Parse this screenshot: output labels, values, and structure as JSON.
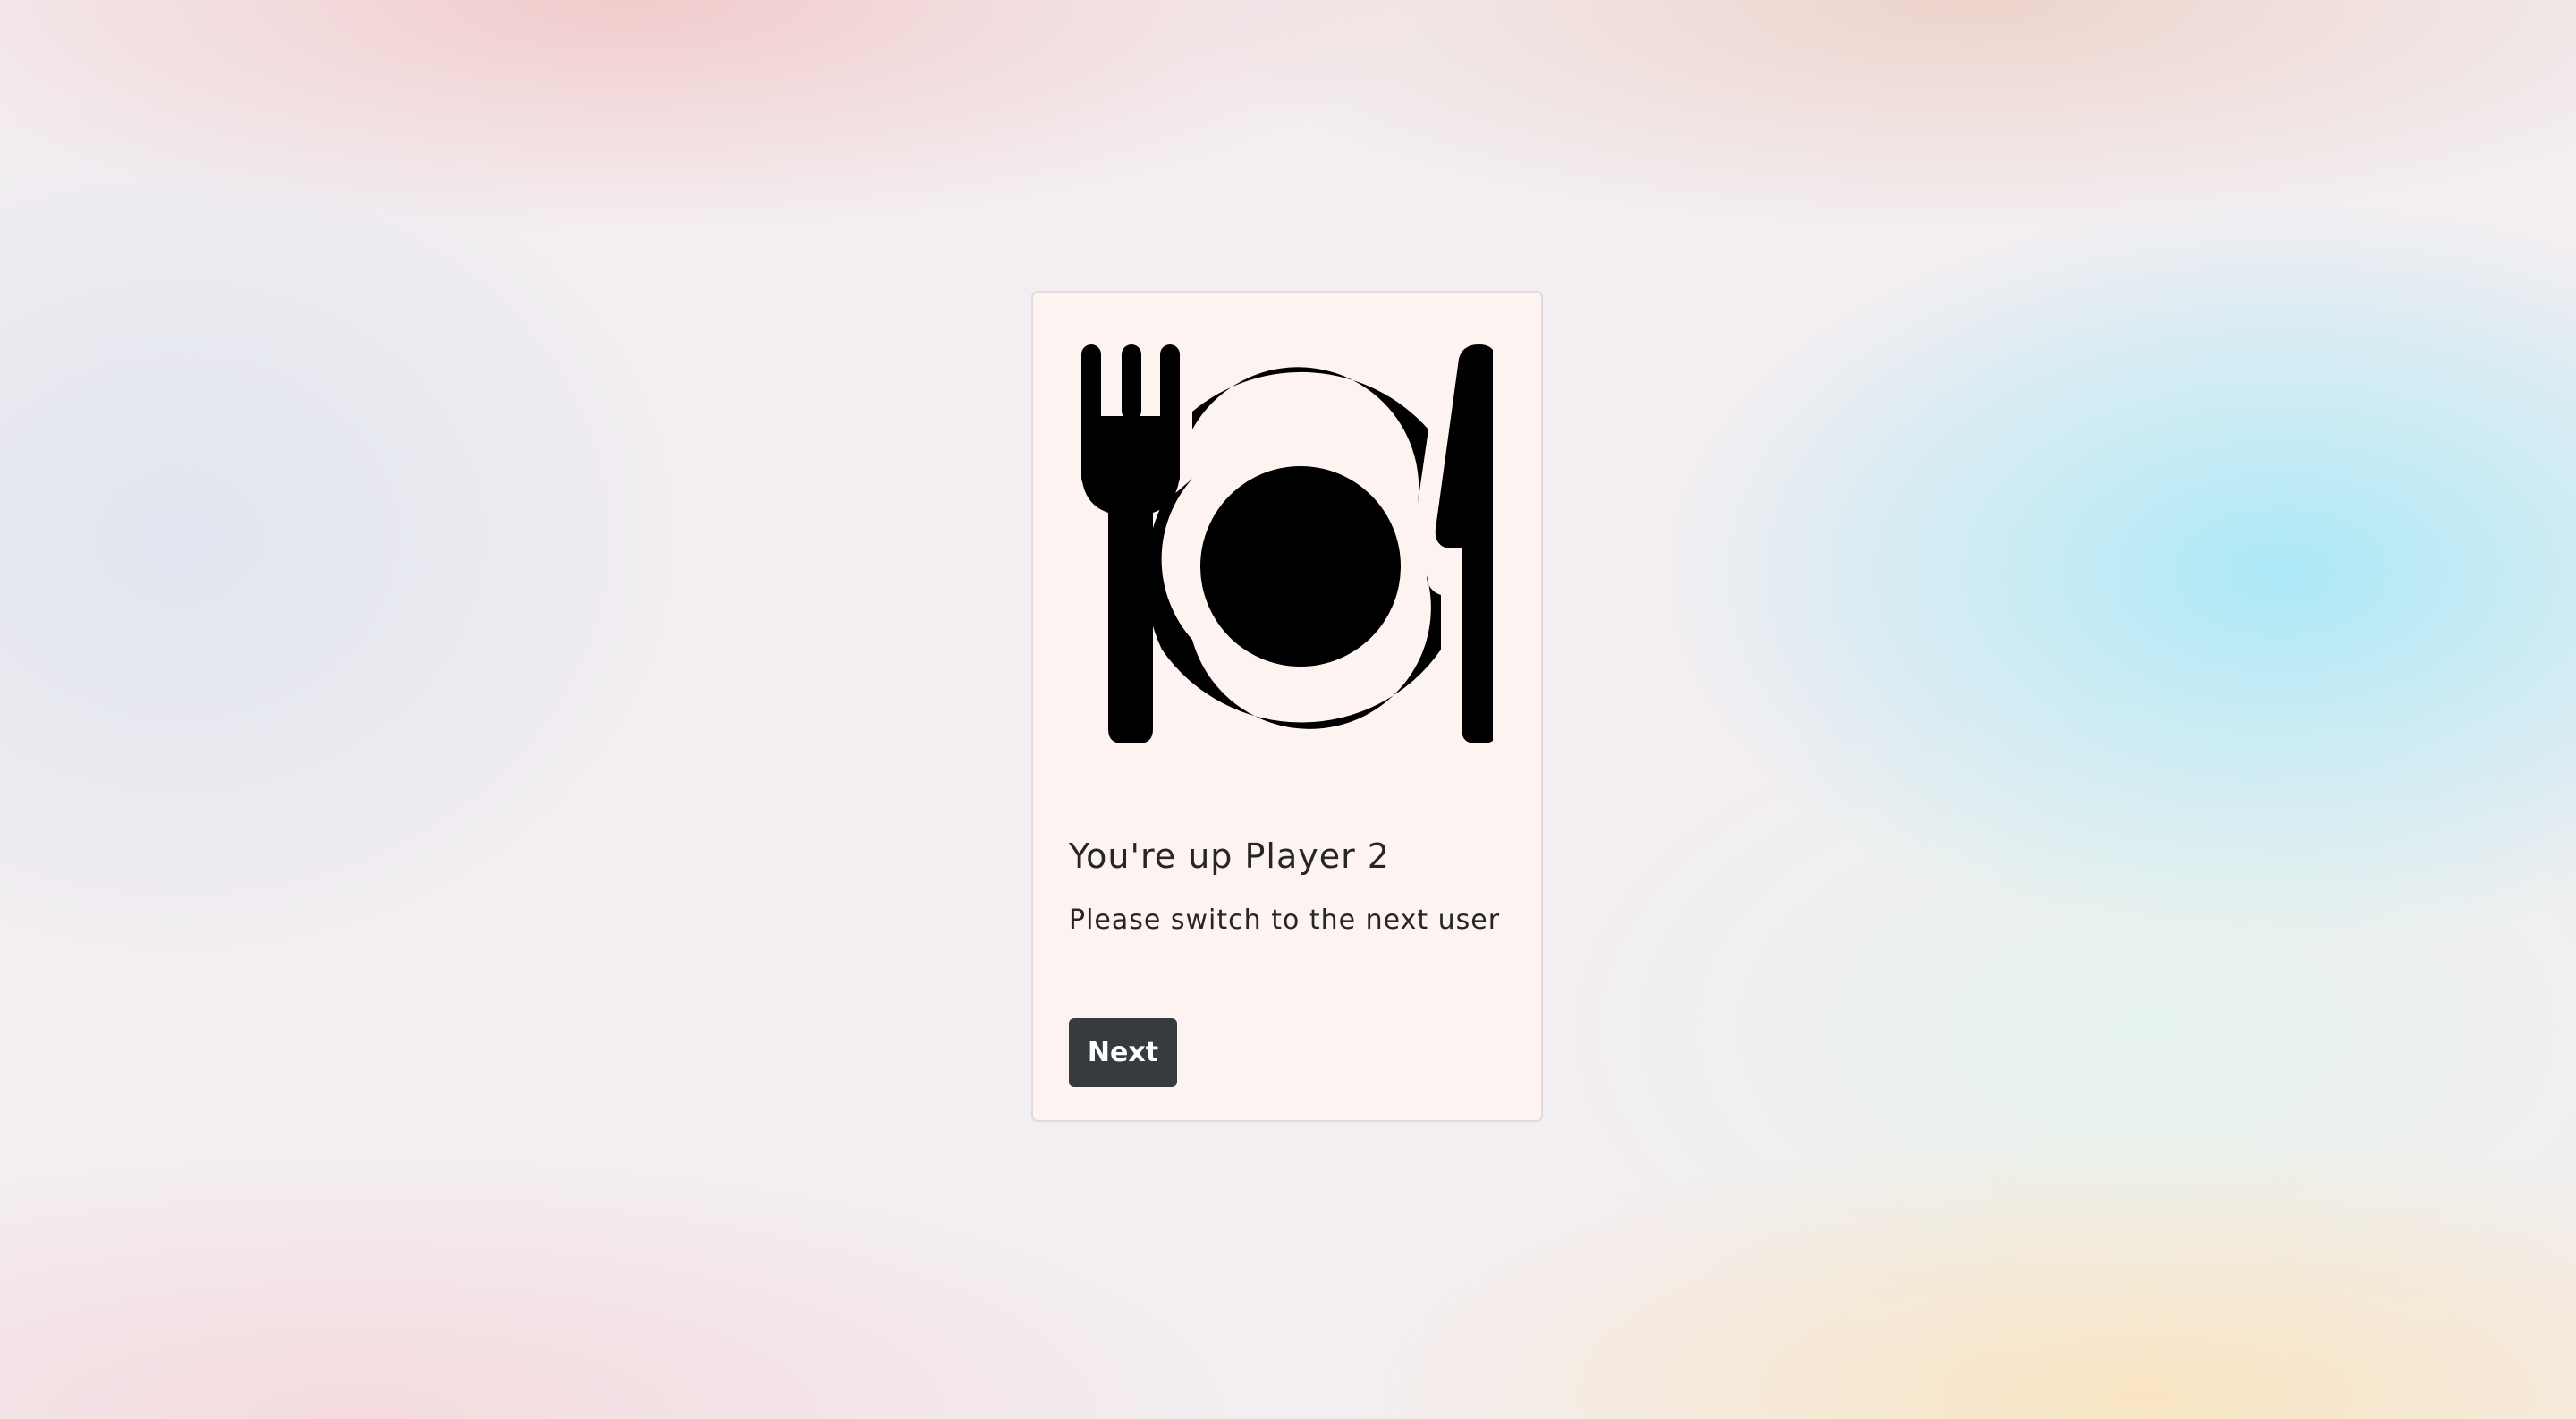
{
  "card": {
    "image_icon": "fork-plate-knife-icon",
    "title": "You're up Player 2",
    "text": "Please switch to the next user",
    "button_label": "Next"
  },
  "colors": {
    "card_background": "#fdf3f1",
    "button_background": "#363b40",
    "button_text": "#ffffff",
    "icon": "#000000"
  }
}
